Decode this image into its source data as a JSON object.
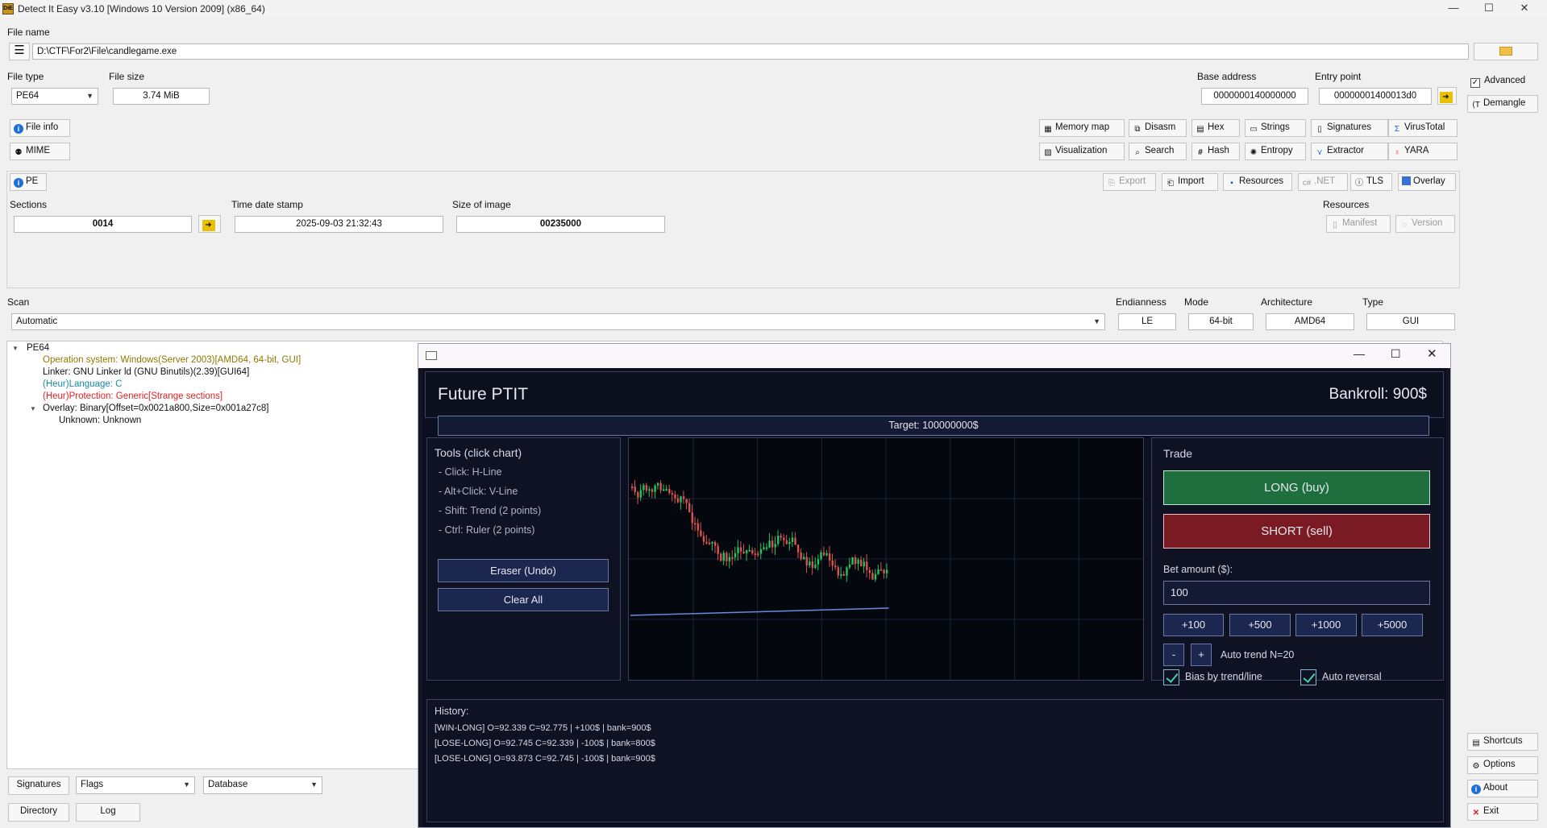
{
  "app": {
    "title": "Detect It Easy v3.10 [Windows 10 Version 2009] (x86_64)",
    "icon_text": "DiE"
  },
  "window_controls": {
    "minimize": "—",
    "maximize": "☐",
    "close": "✕"
  },
  "file": {
    "label": "File name",
    "path": "D:\\CTF\\For2\\File\\candlegame.exe",
    "browse_icon": "folder-icon"
  },
  "filetype": {
    "label": "File type",
    "value": "PE64"
  },
  "filesize": {
    "label": "File size",
    "value": "3.74 MiB"
  },
  "base_address": {
    "label": "Base address",
    "value": "0000000140000000"
  },
  "entry_point": {
    "label": "Entry point",
    "value": "00000001400013d0"
  },
  "right_panel": {
    "advanced": "Advanced",
    "demangle": "Demangle",
    "shortcuts": "Shortcuts",
    "options": "Options",
    "about": "About",
    "exit": "Exit"
  },
  "left_buttons": {
    "file_info": "File info",
    "mime": "MIME"
  },
  "tools": {
    "row1": [
      "Memory map",
      "Disasm",
      "Hex",
      "Strings",
      "Signatures",
      "VirusTotal"
    ],
    "row2": [
      "Visualization",
      "Search",
      "Hash",
      "Entropy",
      "Extractor",
      "YARA"
    ]
  },
  "pe": {
    "button": "PE",
    "tabs": [
      "Export",
      "Import",
      "Resources",
      ".NET",
      "TLS",
      "Overlay"
    ],
    "sections_label": "Sections",
    "sections_value": "0014",
    "timestamp_label": "Time date stamp",
    "timestamp_value": "2025-09-03 21:32:43",
    "image_size_label": "Size of image",
    "image_size_value": "00235000",
    "resources_label": "Resources",
    "manifest": "Manifest",
    "version": "Version"
  },
  "scan": {
    "label": "Scan",
    "mode_value": "Automatic",
    "endianness_label": "Endianness",
    "endianness_value": "LE",
    "mode_label": "Mode",
    "mode_bits": "64-bit",
    "arch_label": "Architecture",
    "arch_value": "AMD64",
    "type_label": "Type",
    "type_value": "GUI"
  },
  "tree": {
    "root": "PE64",
    "items": [
      {
        "text": "Operation system: Windows(Server 2003)[AMD64, 64-bit, GUI]",
        "color": "#8a7a00"
      },
      {
        "text": "Linker: GNU Linker ld (GNU Binutils)(2.39)[GUI64]",
        "color": "#111111"
      },
      {
        "text": "(Heur)Language: C",
        "color": "#1a8aa0"
      },
      {
        "text": "(Heur)Protection: Generic[Strange sections]",
        "color": "#e02020"
      },
      {
        "text": "Overlay: Binary[Offset=0x0021a800,Size=0x001a27c8]",
        "color": "#111111"
      },
      {
        "text": "Unknown: Unknown",
        "color": "#111111"
      }
    ]
  },
  "bottom": {
    "signatures": "Signatures",
    "flags": "Flags",
    "database": "Database",
    "directory": "Directory",
    "log": "Log"
  },
  "game": {
    "title": "Future PTIT",
    "bankroll": "Bankroll: 900$",
    "target": "Target: 100000000$",
    "tools_title": "Tools (click chart)",
    "tools": [
      "- Click: H-Line",
      "- Alt+Click: V-Line",
      "- Shift: Trend (2 points)",
      "- Ctrl: Ruler (2 points)"
    ],
    "eraser": "Eraser (Undo)",
    "clear_all": "Clear All",
    "trade_title": "Trade",
    "long": "LONG (buy)",
    "short": "SHORT (sell)",
    "bet_label": "Bet amount ($):",
    "bet_value": "100",
    "increments": [
      "+100",
      "+500",
      "+1000",
      "+5000"
    ],
    "minus": "-",
    "plus": "+",
    "auto_trend": "Auto trend N=20",
    "bias_label": "Bias by trend/line",
    "auto_reversal": "Auto reversal",
    "history_title": "History:",
    "history": [
      "[WIN-LONG] O=92.339 C=92.775 | +100$ | bank=900$",
      "[LOSE-LONG] O=92.745 C=92.339 | -100$ | bank=800$",
      "[LOSE-LONG] O=93.873 C=92.745 | -100$ | bank=900$"
    ],
    "colors": {
      "long": "#1e6e3e",
      "short": "#7a1a22",
      "up": "#22c55e",
      "down": "#d9534f",
      "trend": "#6a8ae0"
    }
  }
}
